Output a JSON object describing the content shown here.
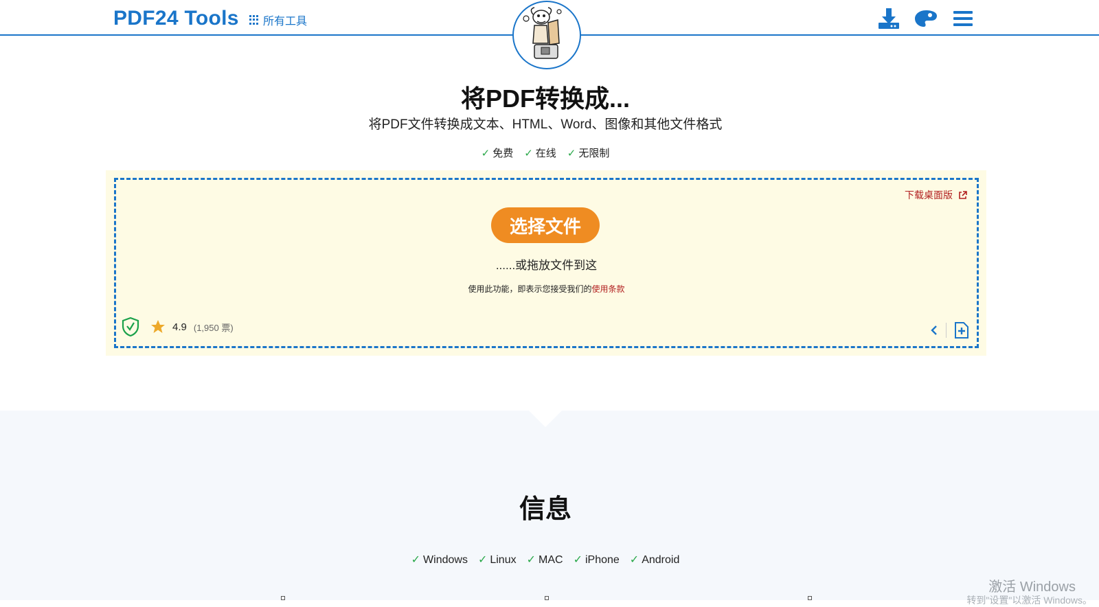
{
  "header": {
    "brand": "PDF24 Tools",
    "all_tools": "所有工具",
    "icons": [
      "download-icon",
      "palette-icon",
      "menu-icon"
    ],
    "accent_color": "#1a75c9"
  },
  "hero": {
    "title": "将PDF转换成...",
    "subtitle": "将PDF文件转换成文本、HTML、Word、图像和其他文件格式",
    "features": [
      "免费",
      "在线",
      "无限制"
    ]
  },
  "upload": {
    "download_desktop": "下载桌面版",
    "choose_button": "选择文件",
    "drop_hint": "......或拖放文件到这",
    "terms_prefix": "使用此功能，即表示您接受我们的",
    "terms_link": "使用条款",
    "rating": "4.9",
    "votes": "(1,950 票)",
    "button_color": "#ef8c22"
  },
  "info": {
    "title": "信息",
    "platforms": [
      "Windows",
      "Linux",
      "MAC",
      "iPhone",
      "Android"
    ]
  },
  "watermark": {
    "line1": "激活 Windows",
    "line2": "转到\"设置\"以激活 Windows。"
  }
}
